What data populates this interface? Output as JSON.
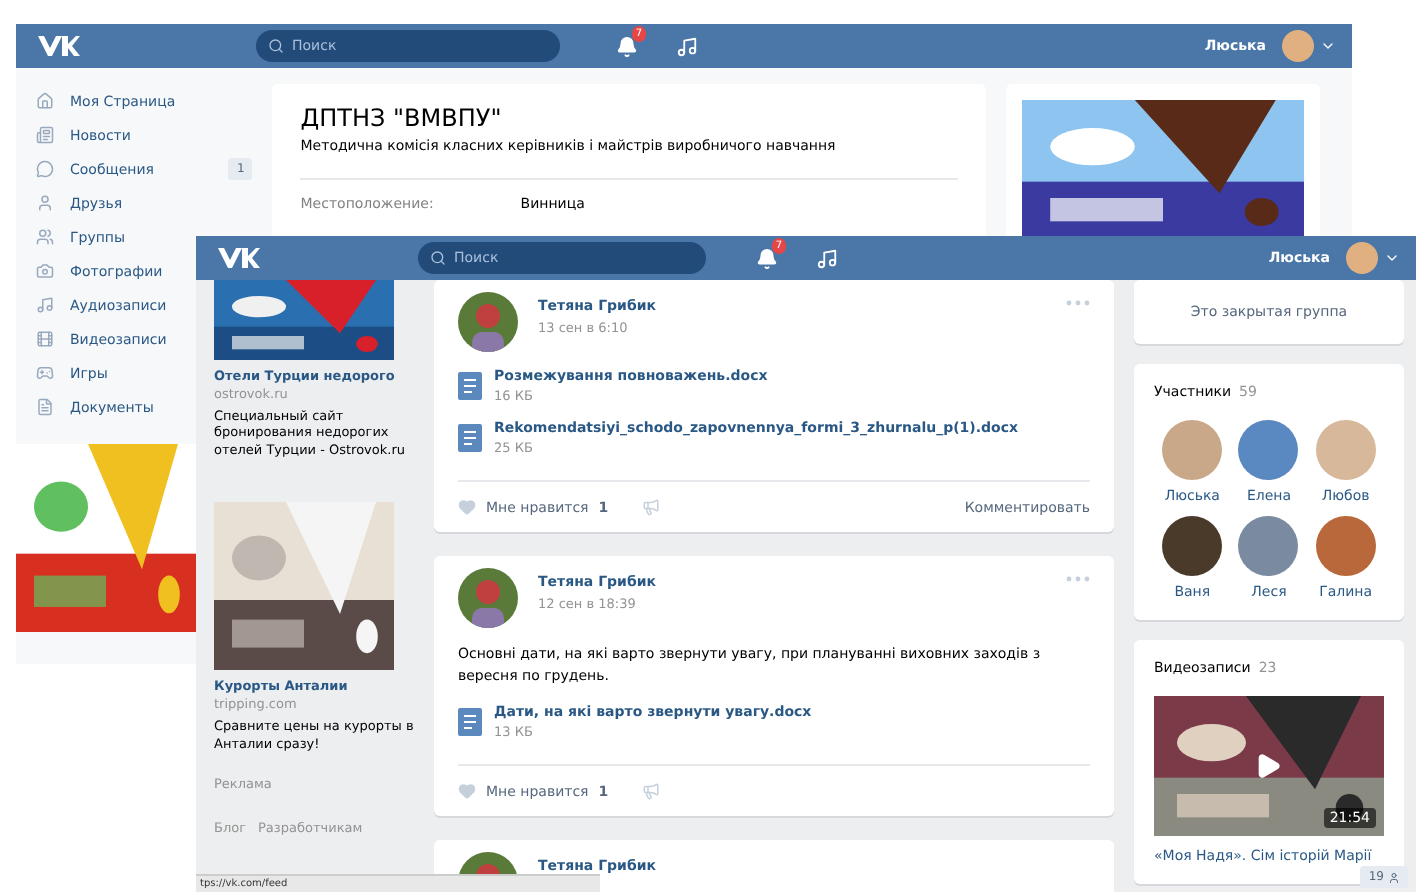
{
  "back_window": {
    "header": {
      "search_placeholder": "Поиск",
      "notifications": "7",
      "user": "Люська"
    },
    "sidebar": {
      "items": [
        {
          "label": "Моя Страница"
        },
        {
          "label": "Новости"
        },
        {
          "label": "Сообщения",
          "badge": "1"
        },
        {
          "label": "Друзья"
        },
        {
          "label": "Группы"
        },
        {
          "label": "Фотографии"
        },
        {
          "label": "Аудиозаписи"
        },
        {
          "label": "Видеозаписи"
        },
        {
          "label": "Игры"
        },
        {
          "label": "Документы"
        }
      ]
    },
    "group": {
      "title": "ДПТНЗ \"ВМВПУ\"",
      "description": "Методична комісія класних керівників і майстрів виробничого навчання",
      "info": [
        {
          "label": "Местоположение:",
          "value": "Винница"
        }
      ]
    }
  },
  "front_window": {
    "header": {
      "search_placeholder": "Поиск",
      "notifications": "7",
      "user": "Люська"
    },
    "ads": [
      {
        "title": "Отели Турции недорого",
        "domain": "ostrovok.ru",
        "text": "Специальный сайт бронирования недорогих отелей Турции - Ostrovok.ru"
      },
      {
        "title": "Курорты Анталии",
        "domain": "tripping.com",
        "text": "Сравните цены на курорты в Анталии сразу!"
      }
    ],
    "ads_label": "Реклама",
    "footer_links": [
      "Блог",
      "Разработчикам"
    ],
    "posts": [
      {
        "author": "Тетяна Грибик",
        "date": "13 сен в 6:10",
        "attachments": [
          {
            "name": "Розмежування повноважень.docx",
            "size": "16 КБ"
          },
          {
            "name": "Rekomendatsiyi_schodo_zapovnennya_formi_3_zhurnalu_p(1).docx",
            "size": "25 КБ"
          }
        ],
        "like_label": "Мне нравится",
        "likes": "1",
        "comment_label": "Комментировать"
      },
      {
        "author": "Тетяна Грибик",
        "date": "12 сен в 18:39",
        "text": "Основні дати, на які варто звернути увагу, при плануванні виховних заходів з вересня по грудень.",
        "attachments": [
          {
            "name": "Дати, на які варто звернути увагу.docx",
            "size": "13 КБ"
          }
        ],
        "like_label": "Мне нравится",
        "likes": "1"
      }
    ],
    "next_post_author": "Тетяна Грибик",
    "closed_group": "Это закрытая группа",
    "members": {
      "title": "Участники",
      "count": "59",
      "people": [
        {
          "name": "Люська",
          "color": "#c9a88a"
        },
        {
          "name": "Елена",
          "color": "#5a88c0"
        },
        {
          "name": "Любов",
          "color": "#d8b89a"
        },
        {
          "name": "Ваня",
          "color": "#4a3a2a"
        },
        {
          "name": "Леся",
          "color": "#7a8aa0"
        },
        {
          "name": "Галина",
          "color": "#b8683a"
        }
      ]
    },
    "videos": {
      "title": "Видеозаписи",
      "count": "23",
      "items": [
        {
          "title": "«Моя Надя». Сім історій Марії",
          "duration": "21:54"
        }
      ]
    },
    "status_url": "tps://vk.com/feed",
    "online_count": "19"
  }
}
